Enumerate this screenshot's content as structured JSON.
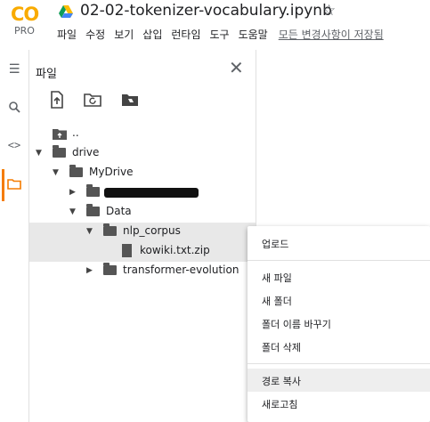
{
  "logo": {
    "mark": "CO",
    "tier": "PRO"
  },
  "notebook": {
    "title": "02-02-tokenizer-vocabulary.ipynb",
    "star_icon": "☆"
  },
  "menu": {
    "items": [
      "파일",
      "수정",
      "보기",
      "삽입",
      "런타임",
      "도구",
      "도움말"
    ],
    "save_status": "모든 변경사항이 저장됨"
  },
  "files_panel": {
    "title": "파일",
    "icons": [
      "upload-icon",
      "refresh-folder-icon",
      "drive-folder-icon"
    ],
    "tree": [
      {
        "label": "..",
        "type": "parent"
      },
      {
        "label": "drive",
        "type": "folder",
        "expanded": true
      },
      {
        "label": "MyDrive",
        "type": "folder",
        "expanded": true
      },
      {
        "label": "",
        "type": "folder",
        "expanded": false,
        "redacted": true
      },
      {
        "label": "Data",
        "type": "folder",
        "expanded": true
      },
      {
        "label": "nlp_corpus",
        "type": "folder",
        "expanded": true,
        "selected": true
      },
      {
        "label": "kowiki.txt.zip",
        "type": "file",
        "selected": true
      },
      {
        "label": "transformer-evolution",
        "type": "folder",
        "expanded": false
      }
    ]
  },
  "context_menu": {
    "upload": "업로드",
    "new_file": "새 파일",
    "new_folder": "새 폴더",
    "rename_folder": "폴더 이름 바꾸기",
    "delete_folder": "폴더 삭제",
    "copy_path": "경로 복사",
    "refresh": "새로고침"
  },
  "colors": {
    "accent": "#f57c00",
    "logo_yellow": "#f9ab00",
    "selection": "#e8e8e8"
  }
}
